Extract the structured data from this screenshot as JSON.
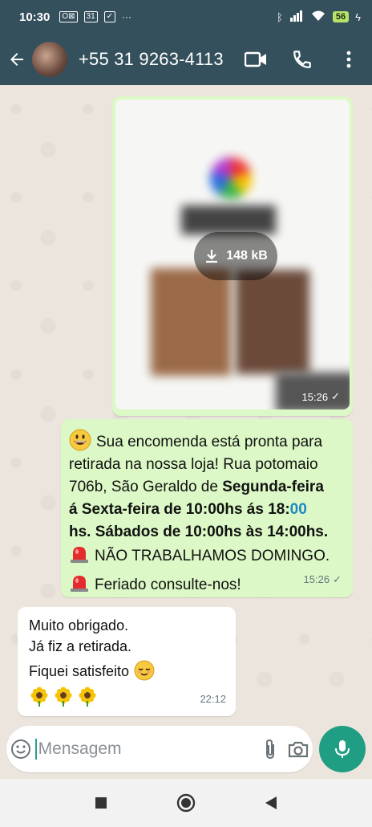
{
  "status_bar": {
    "time": "10:30",
    "calendar_day": "31",
    "battery": "56"
  },
  "header": {
    "contact": "+55 31 9263-4113"
  },
  "messages": {
    "image": {
      "size_label": "148 kB",
      "time": "15:26"
    },
    "text": {
      "lines": [
        {
          "pre": "Sua encomenda está pronta para"
        },
        {
          "pre": "retirada na nossa loja! Rua potomaio"
        },
        {
          "pre": "706b, São Geraldo de ",
          "bold": "Segunda-feira"
        },
        {
          "bold": "á Sexta-feira de 10:00hs ás 18:",
          "link": "00"
        },
        {
          "bold": "hs. Sábados de 10:00hs  às 14:00hs."
        },
        {
          "pre": "NÃO TRABALHAMOS DOMINGO."
        },
        {
          "pre": "Feriado consulte-nos!"
        }
      ],
      "time": "15:26"
    },
    "incoming": {
      "lines": [
        "Muito obrigado.",
        "Já fiz a retirada.",
        "Fiquei satisfeito"
      ],
      "time": "22:12"
    }
  },
  "input": {
    "placeholder": "Mensagem"
  },
  "icons": {
    "back": "arrow-left-icon",
    "video": "video-camera-icon",
    "call": "phone-icon",
    "menu": "more-vert-icon",
    "emoji": "emoji-icon",
    "attach": "paperclip-icon",
    "camera": "camera-icon",
    "mic": "microphone-icon"
  },
  "colors": {
    "header": "#35505d",
    "outgoing": "#dcf8c6",
    "incoming": "#ffffff",
    "accent": "#1f9e84",
    "link": "#1e88c7"
  }
}
